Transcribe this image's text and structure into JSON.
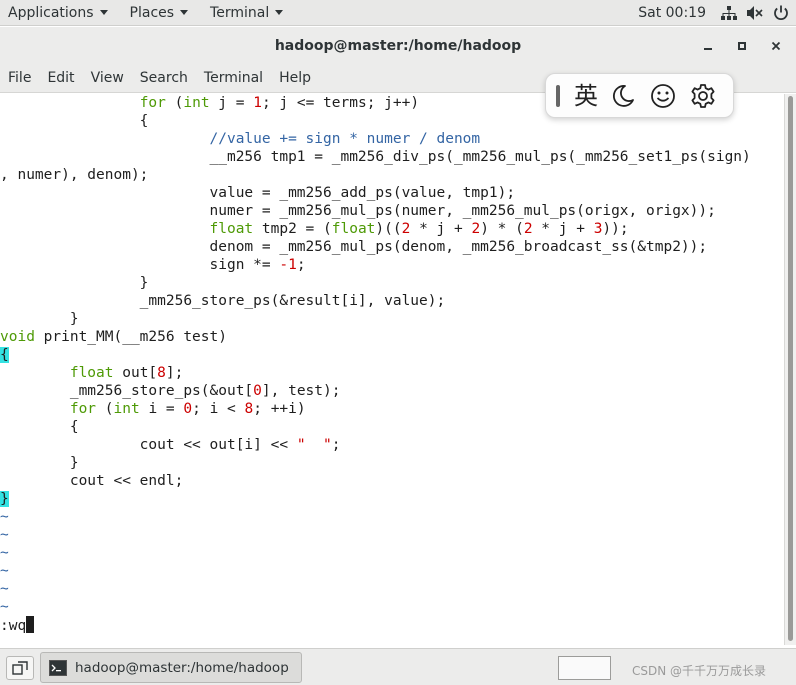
{
  "topbar": {
    "applications": "Applications",
    "places": "Places",
    "terminal": "Terminal",
    "clock": "Sat 00:19",
    "icons": [
      "network-icon",
      "volume-icon",
      "power-icon"
    ]
  },
  "window": {
    "title": "hadoop@master:/home/hadoop",
    "buttons": [
      "minimize-icon",
      "maximize-icon",
      "close-icon"
    ]
  },
  "menu": {
    "items": [
      "File",
      "Edit",
      "View",
      "Search",
      "Terminal",
      "Help"
    ]
  },
  "ime": {
    "lang": "英",
    "icons": [
      "moon-icon",
      "smiley-icon",
      "gear-icon"
    ]
  },
  "editor": {
    "lines": [
      "                for (int j = 1; j <= terms; j++)",
      "                {",
      "                        //value += sign * numer / denom",
      "                        __m256 tmp1 = _mm256_div_ps(_mm256_mul_ps(_mm256_set1_ps(sign)",
      ", numer), denom);",
      "                        value = _mm256_add_ps(value, tmp1);",
      "                        numer = _mm256_mul_ps(numer, _mm256_mul_ps(origx, origx));",
      "                        float tmp2 = (float)((2 * j + 2) * (2 * j + 3));",
      "                        denom = _mm256_mul_ps(denom, _mm256_broadcast_ss(&tmp2));",
      "                        sign *= -1;",
      "                }",
      "                _mm256_store_ps(&result[i], value);",
      "        }",
      "void print_MM(__m256 test)",
      "{",
      "        float out[8];",
      "        _mm256_store_ps(&out[0], test);",
      "        for (int i = 0; i < 8; ++i)",
      "        {",
      "                cout << out[i] << \"  \";",
      "        }",
      "        cout << endl;",
      "}",
      "~",
      "~",
      "~",
      "~",
      "~",
      "~"
    ],
    "command": ":wq"
  },
  "taskbar": {
    "task_label": "hadoop@master:/home/hadoop",
    "watermark": "CSDN @千千万万成长录"
  }
}
